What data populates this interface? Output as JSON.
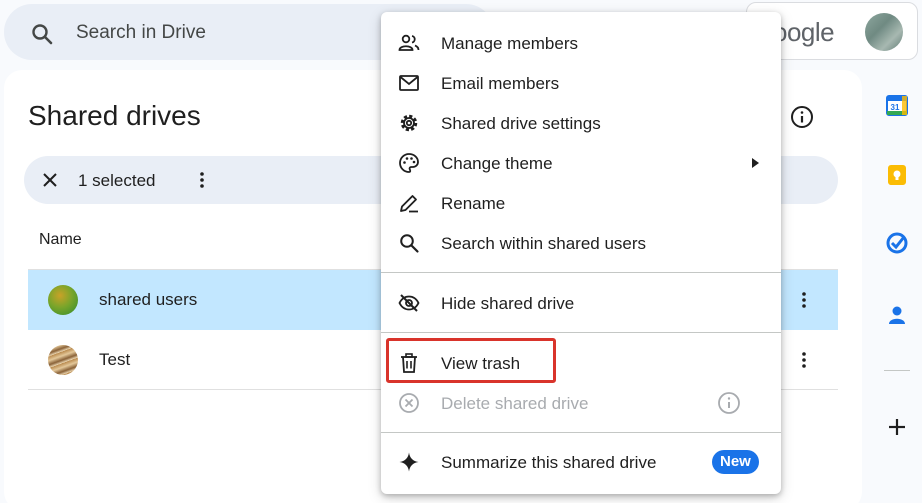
{
  "search": {
    "placeholder": "Search in Drive"
  },
  "brand": {
    "logo_text": "oogle"
  },
  "page": {
    "title": "Shared drives"
  },
  "selection": {
    "count_label": "1 selected"
  },
  "list": {
    "column_header": "Name",
    "rows": [
      {
        "name": "shared users",
        "selected": true
      },
      {
        "name": "Test",
        "selected": false
      }
    ]
  },
  "context_menu": {
    "items": [
      {
        "label": "Manage members",
        "icon": "people-icon"
      },
      {
        "label": "Email members",
        "icon": "mail-icon"
      },
      {
        "label": "Shared drive settings",
        "icon": "gear-icon"
      },
      {
        "label": "Change theme",
        "icon": "palette-icon",
        "has_submenu": true
      },
      {
        "label": "Rename",
        "icon": "pencil-icon"
      },
      {
        "label": "Search within shared users",
        "icon": "search-icon"
      },
      {
        "label": "Hide shared drive",
        "icon": "eye-off-icon"
      },
      {
        "label": "View trash",
        "icon": "trash-icon",
        "highlighted": true
      },
      {
        "label": "Delete shared drive",
        "icon": "cancel-circle-icon",
        "disabled": true
      },
      {
        "label": "Summarize this shared drive",
        "icon": "sparkle-icon",
        "badge": "New"
      }
    ]
  },
  "side_panel": {
    "apps": [
      "calendar-icon",
      "keep-icon",
      "tasks-icon",
      "contacts-icon",
      "add-icon"
    ]
  },
  "colors": {
    "selected_row": "#c2e7ff",
    "badge": "#1a73e8",
    "highlight_box": "#d9342b"
  }
}
